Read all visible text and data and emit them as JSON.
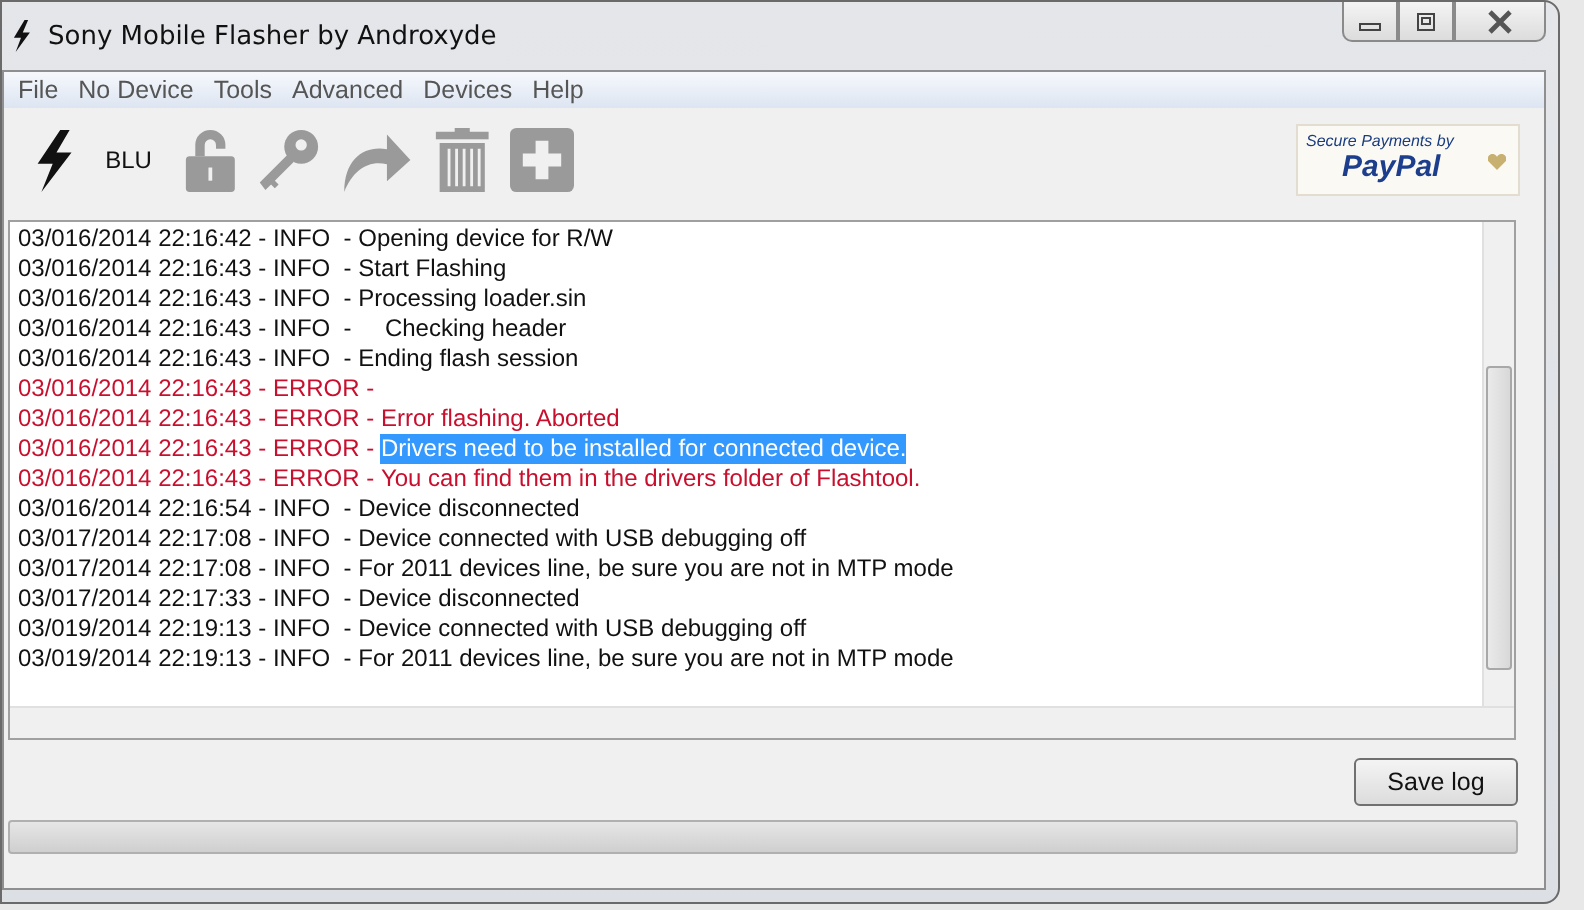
{
  "window": {
    "title": "Sony Mobile Flasher by Androxyde"
  },
  "menu": [
    "File",
    "No Device",
    "Tools",
    "Advanced",
    "Devices",
    "Help"
  ],
  "toolbar": {
    "device_label": "BLU",
    "buttons": [
      {
        "kind": "flash",
        "disabled": false
      },
      {
        "kind": "unlock",
        "disabled": true
      },
      {
        "kind": "key",
        "disabled": true
      },
      {
        "kind": "redo",
        "disabled": true
      },
      {
        "kind": "trash",
        "disabled": true
      },
      {
        "kind": "plus",
        "disabled": true
      }
    ]
  },
  "paypal": {
    "caption": "Secure Payments by",
    "brand": "PayPal"
  },
  "log": [
    {
      "kind": "info",
      "prefix": "03/016/2014 22:16:42 - INFO  - ",
      "message": "Opening device for R/W",
      "selected": false
    },
    {
      "kind": "info",
      "prefix": "03/016/2014 22:16:43 - INFO  - ",
      "message": "Start Flashing",
      "selected": false
    },
    {
      "kind": "info",
      "prefix": "03/016/2014 22:16:43 - INFO  - ",
      "message": "Processing loader.sin",
      "selected": false
    },
    {
      "kind": "info",
      "prefix": "03/016/2014 22:16:43 - INFO  - ",
      "message": "    Checking header",
      "selected": false
    },
    {
      "kind": "info",
      "prefix": "03/016/2014 22:16:43 - INFO  - ",
      "message": "Ending flash session",
      "selected": false
    },
    {
      "kind": "error",
      "prefix": "03/016/2014 22:16:43 - ERROR -",
      "selected": false
    },
    {
      "kind": "error",
      "prefix": "03/016/2014 22:16:43 - ERROR - ",
      "message": "Error flashing. Aborted",
      "selected": false
    },
    {
      "kind": "error",
      "prefix": "03/016/2014 22:16:43 - ERROR - ",
      "message": "Drivers need to be installed for connected device.",
      "selected": true
    },
    {
      "kind": "error",
      "prefix": "03/016/2014 22:16:43 - ERROR - ",
      "message": "You can find them in the drivers folder of Flashtool.",
      "selected": false
    },
    {
      "kind": "info",
      "prefix": "03/016/2014 22:16:54 - INFO  - ",
      "message": "Device disconnected",
      "selected": false
    },
    {
      "kind": "info",
      "prefix": "03/017/2014 22:17:08 - INFO  - ",
      "message": "Device connected with USB debugging off",
      "selected": false
    },
    {
      "kind": "info",
      "prefix": "03/017/2014 22:17:08 - INFO  - ",
      "message": "For 2011 devices line, be sure you are not in MTP mode",
      "selected": false
    },
    {
      "kind": "info",
      "prefix": "03/017/2014 22:17:33 - INFO  - ",
      "message": "Device disconnected",
      "selected": false
    },
    {
      "kind": "info",
      "prefix": "03/019/2014 22:19:13 - INFO  - ",
      "message": "Device connected with USB debugging off",
      "selected": false
    },
    {
      "kind": "info",
      "prefix": "03/019/2014 22:19:13 - INFO  - ",
      "message": "For 2011 devices line, be sure you are not in MTP mode",
      "selected": false
    }
  ],
  "save_button": "Save log",
  "progress": {
    "level": 0
  }
}
